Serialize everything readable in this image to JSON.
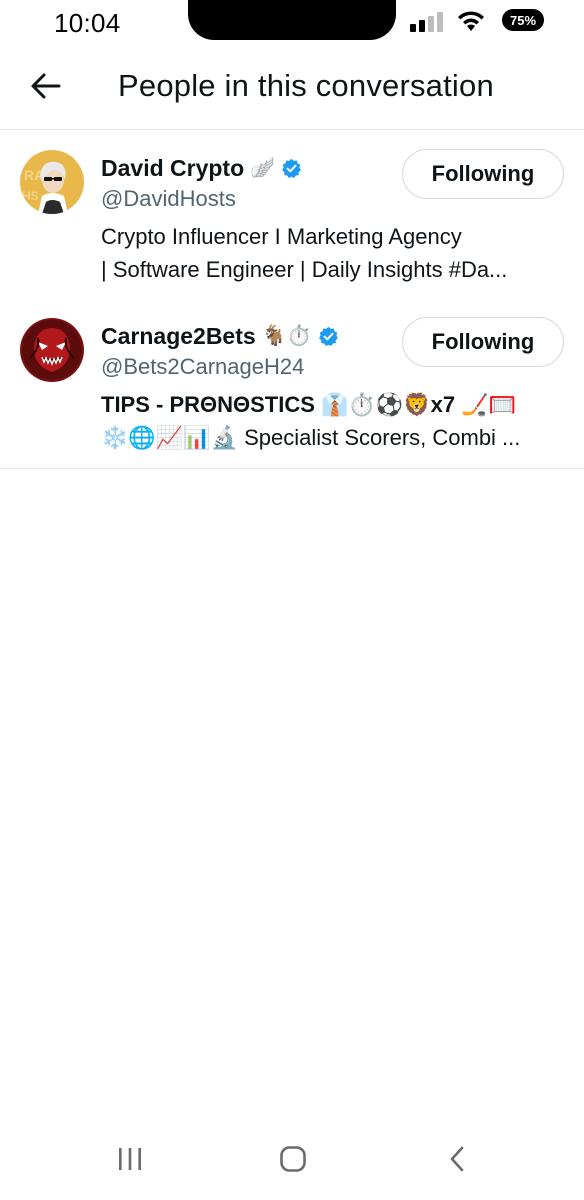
{
  "status_bar": {
    "time": "10:04",
    "battery": "75%"
  },
  "header": {
    "title": "People in this conversation",
    "back_icon": "arrow-left-icon"
  },
  "people": [
    {
      "name": "David Crypto",
      "badge": "🪽",
      "verified": true,
      "handle": "@DavidHosts",
      "bio_line1": "Crypto Influencer I Marketing Agency",
      "bio_line2": "| Software Engineer | Daily Insights #Da...",
      "follow_label": "Following"
    },
    {
      "name": "Carnage2Bets",
      "badge": "🐐⏱️",
      "verified": true,
      "handle": "@Bets2CarnageH24",
      "bio_line1": "TIPS - PRΘNΘSTICS 👔⏱️⚽🦁x7 🏒🥅",
      "bio_line2": "❄️🌐📈📊🔬 Specialist Scorers, Combi ...",
      "follow_label": "Following"
    }
  ],
  "colors": {
    "verified": "#1d9bf0",
    "secondary_text": "#536471",
    "border": "#cfd9de"
  },
  "nav_bar": {
    "recents_icon": "recents-icon",
    "home_icon": "home-icon",
    "back_icon": "back-chevron-icon"
  }
}
